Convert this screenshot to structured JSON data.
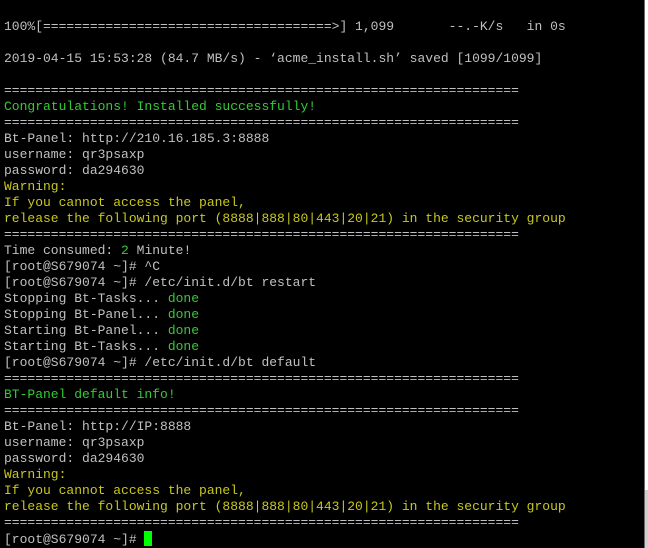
{
  "terminal": {
    "lines": [
      {
        "segs": [
          {
            "t": "100%[=====================================>] 1,099       --.-K/s   in 0s",
            "c": "w"
          }
        ]
      },
      {
        "segs": [
          {
            "t": "",
            "c": "w"
          }
        ]
      },
      {
        "segs": [
          {
            "t": "2019-04-15 15:53:28 (84.7 MB/s) - ‘acme_install.sh’ saved [1099/1099]",
            "c": "w"
          }
        ]
      },
      {
        "segs": [
          {
            "t": "",
            "c": "w"
          }
        ]
      },
      {
        "segs": [
          {
            "t": "==================================================================",
            "c": "w"
          }
        ]
      },
      {
        "segs": [
          {
            "t": "Congratulations! Installed successfully!",
            "c": "g"
          }
        ]
      },
      {
        "segs": [
          {
            "t": "==================================================================",
            "c": "w"
          }
        ]
      },
      {
        "segs": [
          {
            "t": "Bt-Panel: http://210.16.185.3:8888",
            "c": "w"
          }
        ]
      },
      {
        "segs": [
          {
            "t": "username: qr3psaxp",
            "c": "w"
          }
        ]
      },
      {
        "segs": [
          {
            "t": "password: da294630",
            "c": "w"
          }
        ]
      },
      {
        "segs": [
          {
            "t": "Warning:",
            "c": "y"
          }
        ]
      },
      {
        "segs": [
          {
            "t": "If you cannot access the panel,",
            "c": "y"
          }
        ]
      },
      {
        "segs": [
          {
            "t": "release the following port (8888|888|80|443|20|21) in the security group",
            "c": "y"
          }
        ]
      },
      {
        "segs": [
          {
            "t": "==================================================================",
            "c": "w"
          }
        ]
      },
      {
        "segs": [
          {
            "t": "Time consumed: ",
            "c": "w"
          },
          {
            "t": "2",
            "c": "g"
          },
          {
            "t": " Minute!",
            "c": "w"
          }
        ]
      },
      {
        "segs": [
          {
            "t": "[root@S679074 ~]# ^C",
            "c": "w"
          }
        ]
      },
      {
        "segs": [
          {
            "t": "[root@S679074 ~]# /etc/init.d/bt restart",
            "c": "w"
          }
        ]
      },
      {
        "segs": [
          {
            "t": "Stopping Bt-Tasks... ",
            "c": "w"
          },
          {
            "t": "done",
            "c": "g"
          }
        ]
      },
      {
        "segs": [
          {
            "t": "Stopping Bt-Panel... ",
            "c": "w"
          },
          {
            "t": "done",
            "c": "g"
          }
        ]
      },
      {
        "segs": [
          {
            "t": "Starting Bt-Panel... ",
            "c": "w"
          },
          {
            "t": "done",
            "c": "g"
          }
        ]
      },
      {
        "segs": [
          {
            "t": "Starting Bt-Tasks... ",
            "c": "w"
          },
          {
            "t": "done",
            "c": "g"
          }
        ]
      },
      {
        "segs": [
          {
            "t": "[root@S679074 ~]# /etc/init.d/bt default",
            "c": "w"
          }
        ]
      },
      {
        "segs": [
          {
            "t": "==================================================================",
            "c": "w"
          }
        ]
      },
      {
        "segs": [
          {
            "t": "BT-Panel default info!",
            "c": "g"
          }
        ]
      },
      {
        "segs": [
          {
            "t": "==================================================================",
            "c": "w"
          }
        ]
      },
      {
        "segs": [
          {
            "t": "Bt-Panel: http://IP:8888",
            "c": "w"
          }
        ]
      },
      {
        "segs": [
          {
            "t": "username: qr3psaxp",
            "c": "w"
          }
        ]
      },
      {
        "segs": [
          {
            "t": "password: da294630",
            "c": "w"
          }
        ]
      },
      {
        "segs": [
          {
            "t": "Warning:",
            "c": "y"
          }
        ]
      },
      {
        "segs": [
          {
            "t": "If you cannot access the panel,",
            "c": "y"
          }
        ]
      },
      {
        "segs": [
          {
            "t": "release the following port (8888|888|80|443|20|21) in the security group",
            "c": "y"
          }
        ]
      },
      {
        "segs": [
          {
            "t": "==================================================================",
            "c": "w"
          }
        ]
      },
      {
        "segs": [
          {
            "t": "[root@S679074 ~]# ",
            "c": "w"
          }
        ],
        "cursor": true
      }
    ]
  },
  "colors": {
    "background": "#000000",
    "text": "#c0c0c0",
    "success": "#33cc33",
    "warning": "#c8c81e",
    "cursor": "#00ff00"
  }
}
